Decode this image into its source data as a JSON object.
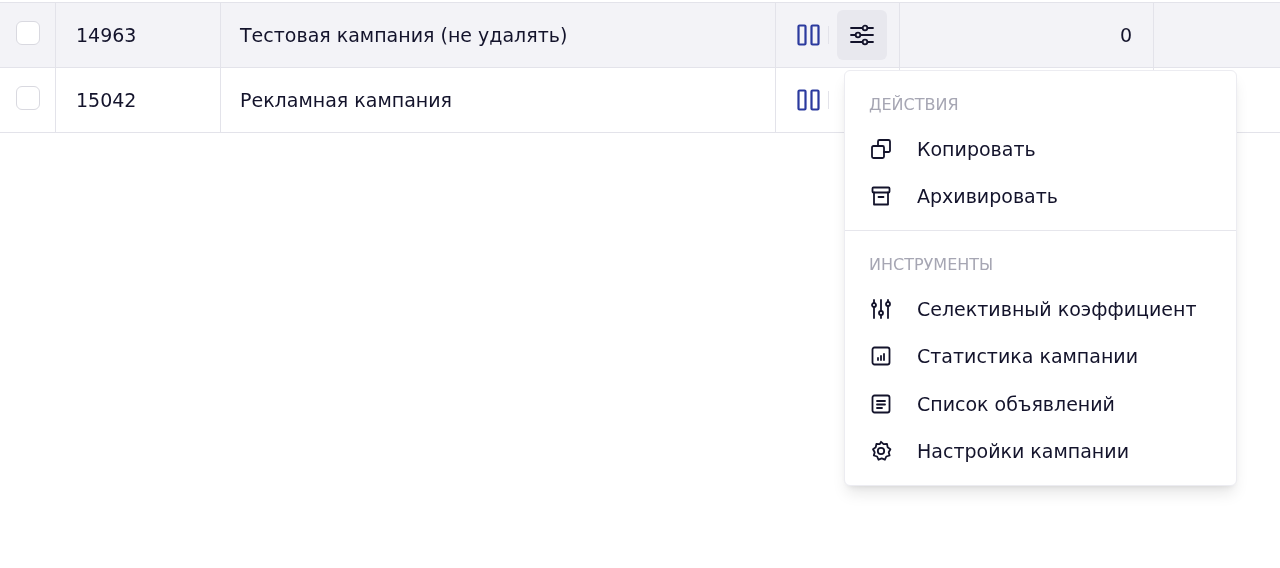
{
  "table": {
    "rows": [
      {
        "checked": false,
        "highlighted": true,
        "id": "14963",
        "name": "Тестовая кампания (не удалять)",
        "menu_open": true,
        "count": "0"
      },
      {
        "checked": false,
        "highlighted": false,
        "id": "15042",
        "name": "Рекламная кампания",
        "menu_open": false
      }
    ]
  },
  "menu": {
    "sections": [
      {
        "title": "ДЕЙСТВИЯ",
        "items": [
          "Копировать",
          "Архивировать"
        ]
      },
      {
        "title": "ИНСТРУМЕНТЫ",
        "items": [
          "Селективный коэффициент",
          "Статистика кампании",
          "Список объявлений",
          "Настройки кампании"
        ]
      }
    ]
  }
}
